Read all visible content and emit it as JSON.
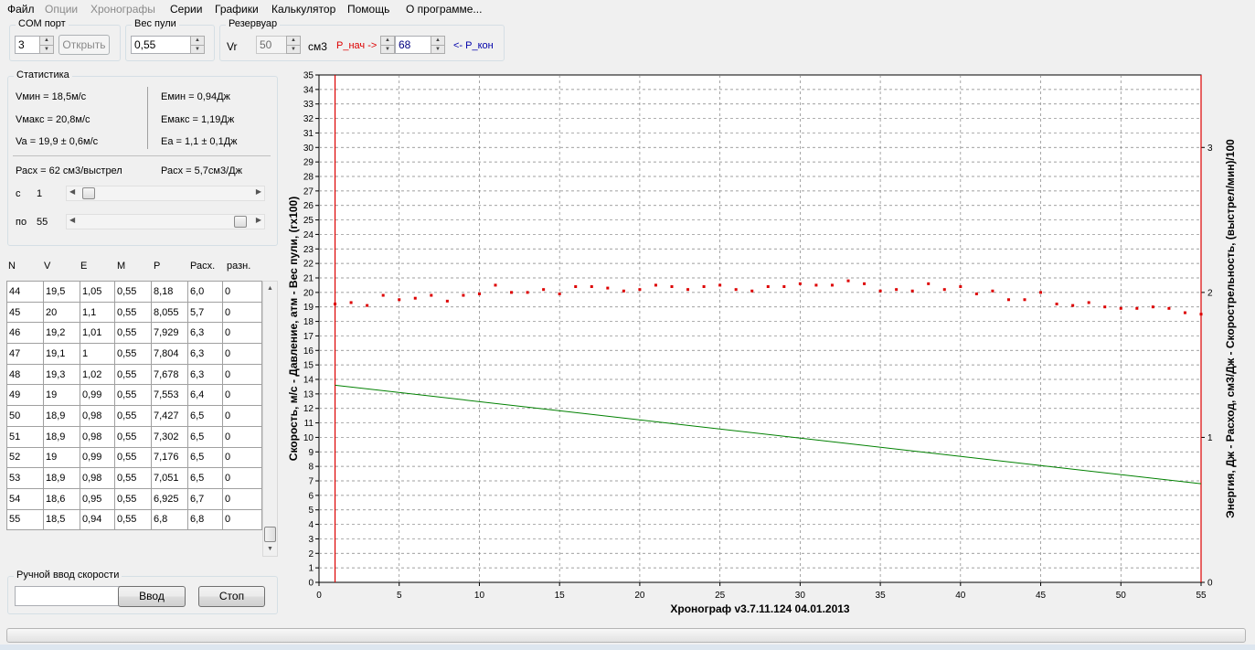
{
  "menu": [
    "Файл",
    "Опции",
    "Хронографы",
    "Серии",
    "Графики",
    "Калькулятор",
    "Помощь",
    "О программе..."
  ],
  "com": {
    "title": "COM порт",
    "value": "3",
    "open_label": "Открыть"
  },
  "bullet": {
    "title": "Вес пули",
    "value": "0,55"
  },
  "reservoir": {
    "title": "Резервуар",
    "vr_label": "Vr",
    "vr_value": "50",
    "unit": "см3",
    "p_start_label": "P_нач ->",
    "p_value": "68",
    "p_end_label": "<- P_кон"
  },
  "stats": {
    "title": "Статистика",
    "vmin": "Vмин = 18,5м/с",
    "vmax": "Vмакс = 20,8м/с",
    "va": "Va = 19,9 ± 0,6м/с",
    "emin": "Емин = 0,94Дж",
    "emax": "Емакс = 1,19Дж",
    "ea": "Еа = 1,1 ± 0,1Дж",
    "consumption_shot": "Расх = 62 см3/выстрел",
    "consumption_j": "Расх = 5,7см3/Дж",
    "from_label": "с",
    "from_value": "1",
    "to_label": "по",
    "to_value": "55"
  },
  "table": {
    "columns": [
      "N",
      "V",
      "E",
      "M",
      "P",
      "Расх.",
      "разн."
    ],
    "rows": [
      [
        "44",
        "19,5",
        "1,05",
        "0,55",
        "8,18",
        "6,0",
        "0"
      ],
      [
        "45",
        "20",
        "1,1",
        "0,55",
        "8,055",
        "5,7",
        "0"
      ],
      [
        "46",
        "19,2",
        "1,01",
        "0,55",
        "7,929",
        "6,3",
        "0"
      ],
      [
        "47",
        "19,1",
        "1",
        "0,55",
        "7,804",
        "6,3",
        "0"
      ],
      [
        "48",
        "19,3",
        "1,02",
        "0,55",
        "7,678",
        "6,3",
        "0"
      ],
      [
        "49",
        "19",
        "0,99",
        "0,55",
        "7,553",
        "6,4",
        "0"
      ],
      [
        "50",
        "18,9",
        "0,98",
        "0,55",
        "7,427",
        "6,5",
        "0"
      ],
      [
        "51",
        "18,9",
        "0,98",
        "0,55",
        "7,302",
        "6,5",
        "0"
      ],
      [
        "52",
        "19",
        "0,99",
        "0,55",
        "7,176",
        "6,5",
        "0"
      ],
      [
        "53",
        "18,9",
        "0,98",
        "0,55",
        "7,051",
        "6,5",
        "0"
      ],
      [
        "54",
        "18,6",
        "0,95",
        "0,55",
        "6,925",
        "6,7",
        "0"
      ],
      [
        "55",
        "18,5",
        "0,94",
        "0,55",
        "6,8",
        "6,8",
        "0"
      ]
    ]
  },
  "manual": {
    "title": "Ручной ввод скорости",
    "value": "",
    "enter_label": "Ввод",
    "stop_label": "Стоп"
  },
  "chart_data": {
    "type": "scatter",
    "xlabel": "Хронограф v3.7.11.124      04.01.2013",
    "ylabel": "Скорость, м/с - Давление, атм - Вес пули, (гх100)",
    "y2label": "Энергия, Дж  -  Расход, см3/Дж - Скорострельность, (выстрел/мин)/100",
    "xlim": [
      0,
      55
    ],
    "ylim": [
      0,
      35
    ],
    "y2lim": [
      0,
      3.5
    ],
    "xticks": [
      0,
      5,
      10,
      15,
      20,
      25,
      30,
      35,
      40,
      45,
      50,
      55
    ],
    "y2ticks": [
      0,
      1,
      2,
      3
    ],
    "vlines": [
      1,
      55
    ],
    "grid": true,
    "colors": {
      "speed": "#dd0000",
      "pressure": "#008000",
      "marker_lines": "#dd0000",
      "grid": "#808080"
    },
    "series": [
      {
        "points": [
          [
            1,
            19.2
          ],
          [
            2,
            19.3
          ],
          [
            3,
            19.1
          ],
          [
            4,
            19.8
          ],
          [
            5,
            19.5
          ],
          [
            6,
            19.6
          ],
          [
            7,
            19.8
          ],
          [
            8,
            19.4
          ],
          [
            9,
            19.8
          ],
          [
            10,
            19.9
          ],
          [
            11,
            20.5
          ],
          [
            12,
            20.0
          ],
          [
            13,
            20.0
          ],
          [
            14,
            20.2
          ],
          [
            15,
            19.9
          ],
          [
            16,
            20.4
          ],
          [
            17,
            20.4
          ],
          [
            18,
            20.3
          ],
          [
            19,
            20.1
          ],
          [
            20,
            20.2
          ],
          [
            21,
            20.5
          ],
          [
            22,
            20.4
          ],
          [
            23,
            20.2
          ],
          [
            24,
            20.4
          ],
          [
            25,
            20.5
          ],
          [
            26,
            20.2
          ],
          [
            27,
            20.1
          ],
          [
            28,
            20.4
          ],
          [
            29,
            20.4
          ],
          [
            30,
            20.6
          ],
          [
            31,
            20.5
          ],
          [
            32,
            20.5
          ],
          [
            33,
            20.8
          ],
          [
            34,
            20.6
          ],
          [
            35,
            20.1
          ],
          [
            36,
            20.2
          ],
          [
            37,
            20.1
          ],
          [
            38,
            20.6
          ],
          [
            39,
            20.2
          ],
          [
            40,
            20.4
          ],
          [
            41,
            19.9
          ],
          [
            42,
            20.1
          ],
          [
            43,
            19.5
          ],
          [
            44,
            19.5
          ],
          [
            45,
            20.0
          ],
          [
            46,
            19.2
          ],
          [
            47,
            19.1
          ],
          [
            48,
            19.3
          ],
          [
            49,
            19.0
          ],
          [
            50,
            18.9
          ],
          [
            51,
            18.9
          ],
          [
            52,
            19.0
          ],
          [
            53,
            18.9
          ],
          [
            54,
            18.6
          ],
          [
            55,
            18.5
          ]
        ]
      },
      {
        "points": [
          [
            1,
            13.6
          ],
          [
            55,
            6.8
          ]
        ]
      }
    ]
  }
}
